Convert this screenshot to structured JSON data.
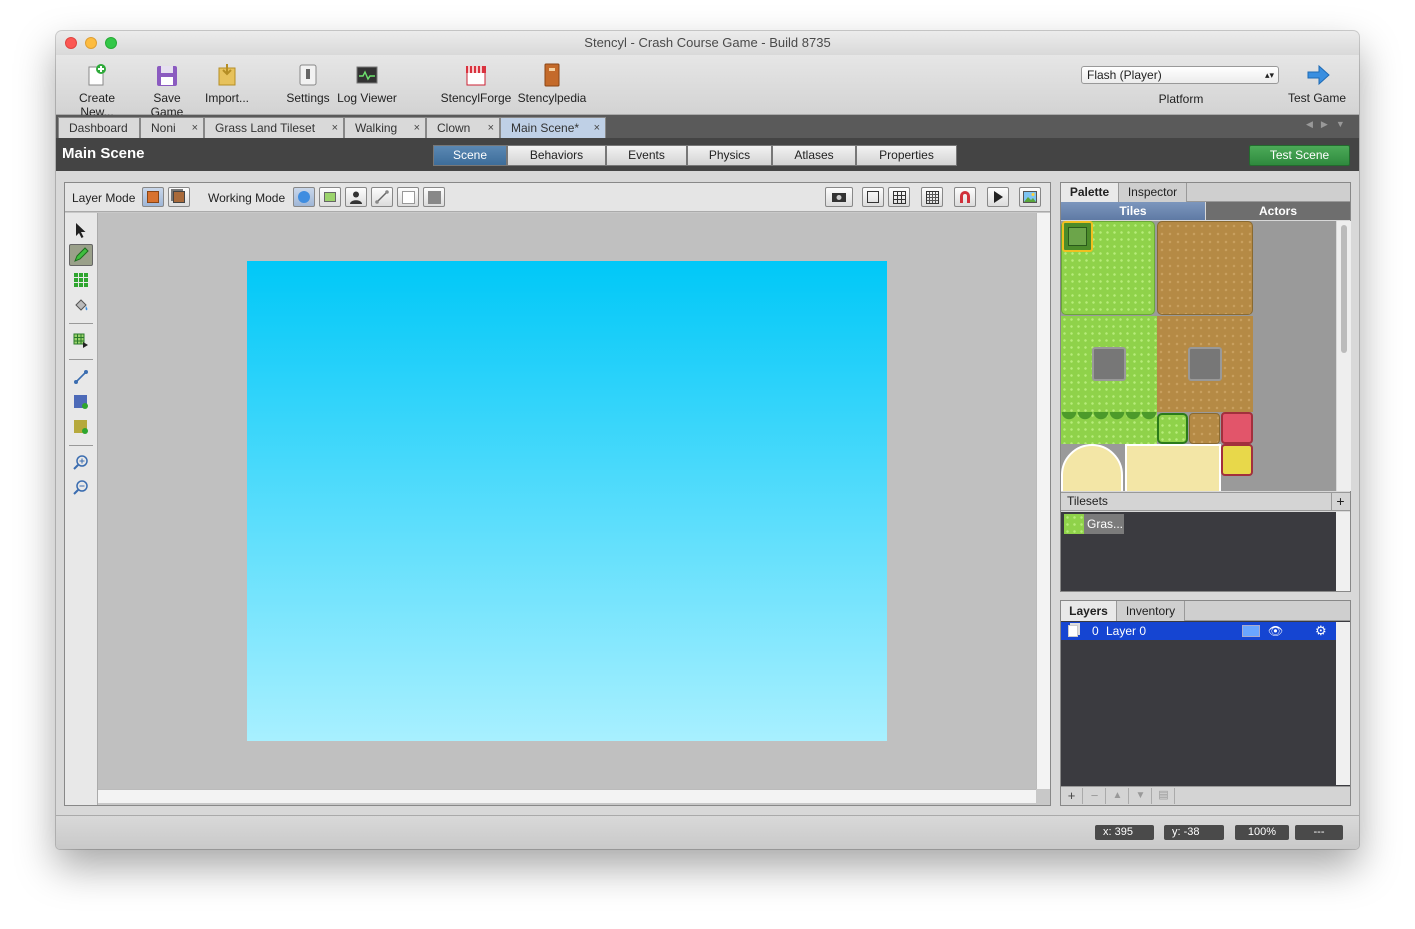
{
  "window": {
    "title": "Stencyl - Crash Course Game - Build 8735"
  },
  "toolbar": {
    "create_new": "Create New...",
    "save_game": "Save Game",
    "import": "Import...",
    "settings": "Settings",
    "log_viewer": "Log Viewer",
    "stencylforge": "StencylForge",
    "stencylpedia": "Stencylpedia",
    "platform_value": "Flash (Player)",
    "platform_label": "Platform",
    "test_game": "Test Game"
  },
  "tabs": [
    {
      "label": "Dashboard"
    },
    {
      "label": "Noni"
    },
    {
      "label": "Grass Land Tileset"
    },
    {
      "label": "Walking"
    },
    {
      "label": "Clown"
    },
    {
      "label": "Main Scene*"
    }
  ],
  "scene": {
    "title": "Main Scene",
    "sections": [
      "Scene",
      "Behaviors",
      "Events",
      "Physics",
      "Atlases",
      "Properties"
    ],
    "test_scene": "Test Scene"
  },
  "editor": {
    "layer_mode_label": "Layer Mode",
    "working_mode_label": "Working Mode"
  },
  "palette": {
    "tabs": [
      "Palette",
      "Inspector"
    ],
    "subtabs": [
      "Tiles",
      "Actors"
    ],
    "tilesets_label": "Tilesets",
    "tileset_name": "Gras..."
  },
  "layers": {
    "tabs": [
      "Layers",
      "Inventory"
    ],
    "rows": [
      {
        "index": "0",
        "name": "Layer 0"
      }
    ]
  },
  "status": {
    "x": "x:  395",
    "y": "y:  -38",
    "zoom": "100%",
    "extra": "---"
  },
  "colors": {
    "scene_top": "#00c8f8",
    "scene_bottom": "#a8f0ff",
    "accent_blue": "#3d6d9a",
    "test_green": "#2f8a3e",
    "layer_selected": "#1545d2"
  }
}
